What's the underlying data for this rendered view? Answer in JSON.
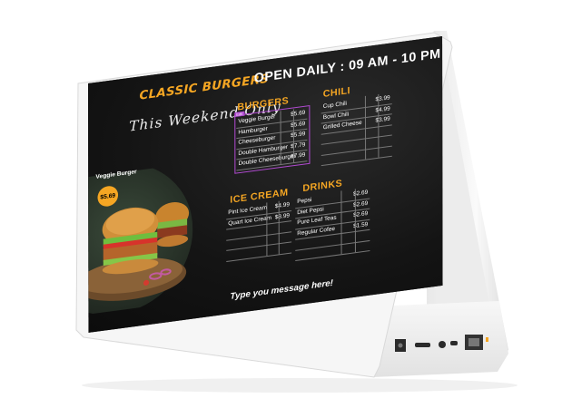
{
  "menu": {
    "brand_title": "CLASSIC BURGERS",
    "hours": "OPEN DAILY : 09 AM - 10 PM",
    "tagline": "This Weekend Only",
    "feature_label": "Veggie Burger",
    "feature_price": "$5.69",
    "burgers_title": "BURGERS",
    "burgers_tag": "Edit",
    "burgers": [
      {
        "name": "Veggie Burger",
        "price": "$5.69"
      },
      {
        "name": "Hamburger",
        "price": "$5.69"
      },
      {
        "name": "Cheeseburger",
        "price": "$5.99"
      },
      {
        "name": "Double Hamburger",
        "price": "$7.79"
      },
      {
        "name": "Double Cheeseburger",
        "price": "$7.99"
      }
    ],
    "chili_title": "CHILI",
    "chili": [
      {
        "name": "Cup Chili",
        "price": "$3.99"
      },
      {
        "name": "Bowl Chili",
        "price": "$4.99"
      },
      {
        "name": "Grilled Cheese",
        "price": "$3.99"
      }
    ],
    "icecream_title": "ICE CREAM",
    "icecream": [
      {
        "name": "Pint Ice Cream",
        "price": "$4.99"
      },
      {
        "name": "Quart Ice Cream",
        "price": "$8.99"
      }
    ],
    "drinks_title": "DRINKS",
    "drinks": [
      {
        "name": "Pepsi",
        "price": "$2.69"
      },
      {
        "name": "Diet Pepsi",
        "price": "$2.69"
      },
      {
        "name": "Pure Leaf Teas",
        "price": "$2.69"
      },
      {
        "name": "Regular Cofee",
        "price": "$1.59"
      }
    ],
    "message": "Type you message here!"
  },
  "colors": {
    "accent": "#f5a623",
    "highlight": "#b04ad0",
    "screen_bg": "#141414",
    "device_body": "#f4f4f4"
  },
  "icons": [
    "camera-icon",
    "dc-power-port-icon",
    "usb-port-icon",
    "usb-c-port-icon",
    "audio-jack-icon",
    "ethernet-port-icon"
  ]
}
